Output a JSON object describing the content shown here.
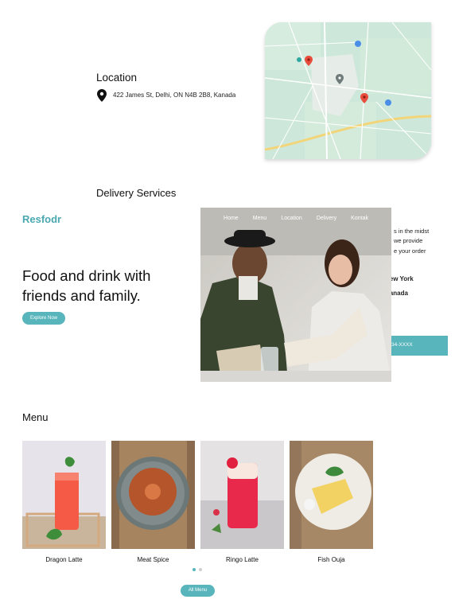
{
  "location": {
    "title": "Location",
    "address": "422 James St, Delhi, ON N4B 2B8, Kanada"
  },
  "delivery": {
    "title": "Delivery Services"
  },
  "hero": {
    "brand": "Resfodr",
    "heading": "Food and drink with friends and family.",
    "cta_label": "Explore Now",
    "nav": [
      "Home",
      "Menu",
      "Location",
      "Delivery",
      "Kontak"
    ]
  },
  "behind_text": {
    "line1": "s in the midst",
    "line2": "we provide",
    "line3": "e your order",
    "line4": "New York",
    "line5": "Kanada",
    "bar_text": "34-XXXX"
  },
  "menu": {
    "title": "Menu",
    "items": [
      {
        "label": "Dragon Latte",
        "image": "red-iced-drink-with-mint"
      },
      {
        "label": "Meat Spice",
        "image": "glazed-cake-on-plate"
      },
      {
        "label": "Ringo Latte",
        "image": "red-latte-in-glass"
      },
      {
        "label": "Fish Ouja",
        "image": "fish-plate-with-greens"
      }
    ],
    "all_label": "All Menu"
  },
  "colors": {
    "accent": "#57b5bb",
    "brand": "#4aa8b0",
    "dot_active": "#57b5bb",
    "dot_inactive": "#cfcfcf"
  },
  "icons": {
    "location_pin": "map-pin-icon"
  }
}
